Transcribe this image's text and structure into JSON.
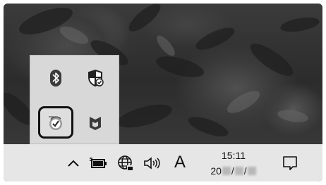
{
  "tray_overflow": {
    "icons": [
      {
        "name": "bluetooth-icon"
      },
      {
        "name": "windows-defender-icon"
      },
      {
        "name": "sync-icon"
      },
      {
        "name": "mcafee-icon"
      }
    ]
  },
  "taskbar": {
    "ime_label": "A",
    "clock": {
      "time": "15:11",
      "date_prefix": "20",
      "date_sep1": "/",
      "date_sep2": "/"
    }
  },
  "colors": {
    "taskbar_bg": "#e6e6e6",
    "panel_bg": "#d8d8d8",
    "highlight_border": "#111111"
  }
}
